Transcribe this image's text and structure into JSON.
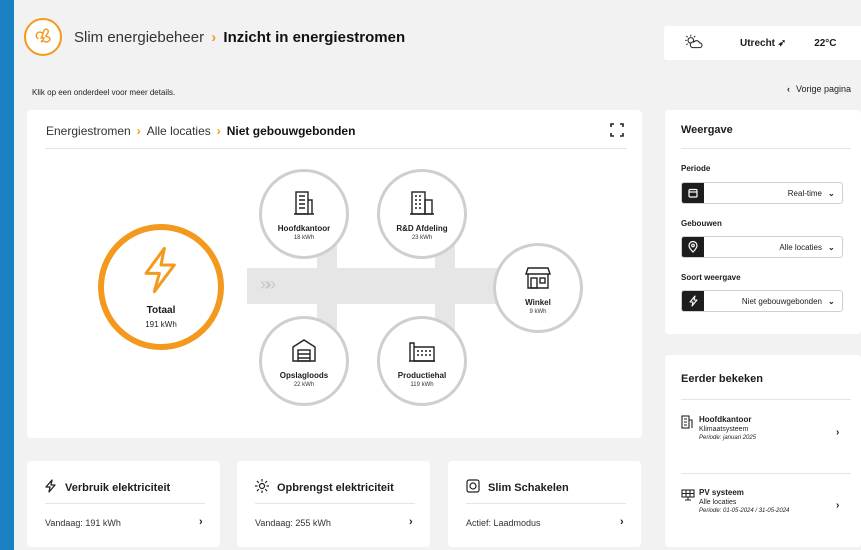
{
  "header": {
    "app_name": "Slim energiebeheer",
    "separator": "›",
    "page_title": "Inzicht in energiestromen"
  },
  "weather": {
    "icon": "partly-sunny-icon",
    "city": "Utrecht",
    "temperature": "22°C"
  },
  "hint": "Klik op een onderdeel voor meer details.",
  "back": {
    "chevron": "‹",
    "label": "Vorige pagina"
  },
  "breadcrumb": {
    "items": [
      "Energiestromen",
      "Alle locaties"
    ],
    "current": "Niet gebouwgebonden",
    "arrow": "›"
  },
  "flow": {
    "total": {
      "label": "Totaal",
      "value": "191 kWh"
    },
    "chevrons": "»»",
    "nodes": [
      {
        "label": "Hoofdkantoor",
        "value": "18 kWh",
        "icon": "office-building-icon"
      },
      {
        "label": "R&D Afdeling",
        "value": "23 kWh",
        "icon": "lab-building-icon"
      },
      {
        "label": "Winkel",
        "value": "9 kWh",
        "icon": "shop-icon"
      },
      {
        "label": "Opslagloods",
        "value": "22 kWh",
        "icon": "warehouse-icon"
      },
      {
        "label": "Productiehal",
        "value": "119 kWh",
        "icon": "factory-icon"
      }
    ]
  },
  "cards": [
    {
      "title": "Verbruik elektriciteit",
      "value": "Vandaag: 191 kWh",
      "icon": "bolt-icon"
    },
    {
      "title": "Opbrengst elektriciteit",
      "value": "Vandaag: 255 kWh",
      "icon": "sun-icon"
    },
    {
      "title": "Slim Schakelen",
      "value": "Actief: Laadmodus",
      "icon": "switch-icon"
    }
  ],
  "view": {
    "title": "Weergave",
    "period_label": "Periode",
    "period_value": "Real-time",
    "buildings_label": "Gebouwen",
    "buildings_value": "Alle locaties",
    "type_label": "Soort weergave",
    "type_value": "Niet gebouwgebonden"
  },
  "recent": {
    "title": "Eerder bekeken",
    "items": [
      {
        "title": "Hoofdkantoor",
        "sub": "Klimaatsysteem",
        "date": "Periode: januari 2025",
        "icon": "office-building-icon"
      },
      {
        "title": "PV systeem",
        "sub": "Alle locaties",
        "date": "Periode: 01-05-2024 / 31-05-2024",
        "icon": "solar-panel-icon"
      }
    ]
  },
  "colors": {
    "accent": "#f39a1e",
    "frame": "#1b7fc4"
  }
}
